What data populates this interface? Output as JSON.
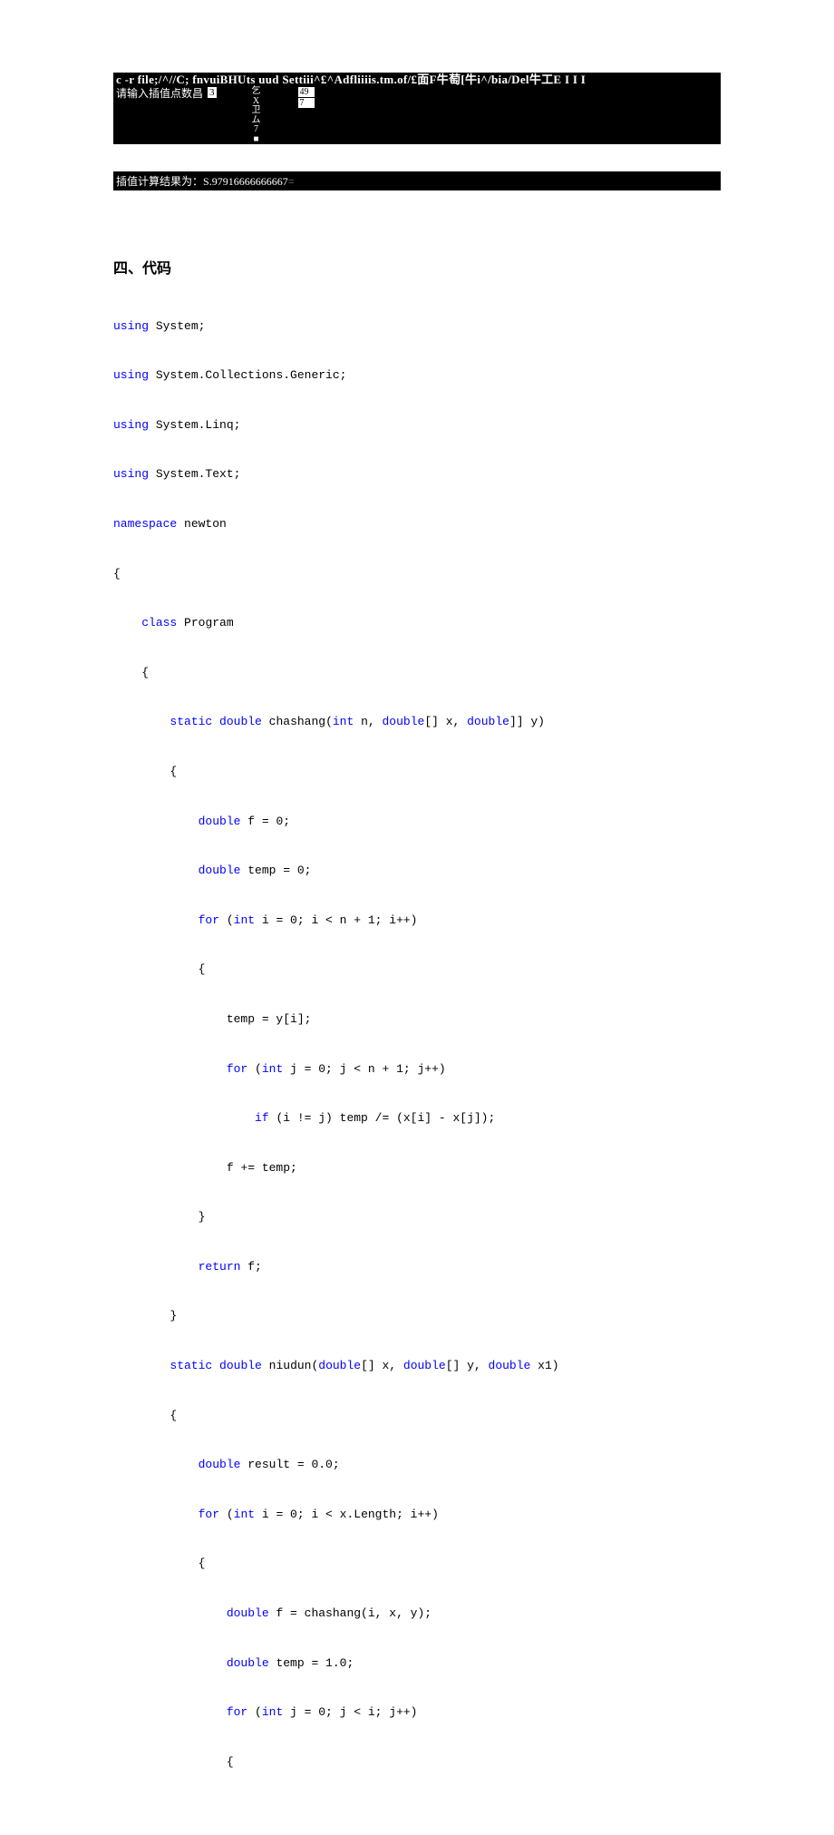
{
  "console": {
    "title": "c -r file;/^//C; fnvuiBHUts uud Settiii^£^Adfliiiis.tm.of/£面F牛萄[牛i^/bia/Del牛工E      I I I",
    "prompt": "请输入插值点数昌",
    "input_count": "3",
    "vertical": [
      "乞",
      "X",
      "卫",
      "ム",
      "7",
      "■"
    ],
    "boxes": [
      "49",
      "7"
    ],
    "result_prefix": "插值计算结果为：",
    "result_value": "S.97916666666667",
    "result_suffix": "="
  },
  "heading": "四、代码",
  "code": {
    "l1a": "using",
    "l1b": " System;",
    "l2a": "using",
    "l2b": " System.Collections.Generic;",
    "l3a": "using",
    "l3b": " System.Linq;",
    "l4a": "using",
    "l4b": " System.Text;",
    "l5a": "namespace",
    "l5b": " newton",
    "l6": "{",
    "l7a": "    ",
    "l7b": "class",
    "l7c": " Program",
    "l8": "    {",
    "l9a": "        ",
    "l9b": "static",
    "l9c": " ",
    "l9d": "double",
    "l9e": " chashang(",
    "l9f": "int",
    "l9g": " n, ",
    "l9h": "double",
    "l9i": "[] x, ",
    "l9j": "double",
    "l9k": "]] y)",
    "l10": "        {",
    "l11a": "            ",
    "l11b": "double",
    "l11c": " f = 0;",
    "l12a": "            ",
    "l12b": "double",
    "l12c": " temp = 0;",
    "l13a": "            ",
    "l13b": "for",
    "l13c": " (",
    "l13d": "int",
    "l13e": " i = 0; i < n + 1; i++)",
    "l14": "            {",
    "l15": "                temp = y[i];",
    "l16a": "                ",
    "l16b": "for",
    "l16c": " (",
    "l16d": "int",
    "l16e": " j = 0; j < n + 1; j++)",
    "l17a": "                    ",
    "l17b": "if",
    "l17c": " (i != j) temp /= (x[i] - x[j]);",
    "l18": "                f += temp;",
    "l19": "            }",
    "l20a": "            ",
    "l20b": "return",
    "l20c": " f;",
    "l21": "        }",
    "l22a": "        ",
    "l22b": "static",
    "l22c": " ",
    "l22d": "double",
    "l22e": " niudun(",
    "l22f": "double",
    "l22g": "[] x, ",
    "l22h": "double",
    "l22i": "[] y, ",
    "l22j": "double",
    "l22k": " x1)",
    "l23": "        {",
    "l24a": "            ",
    "l24b": "double",
    "l24c": " result = 0.0;",
    "l25a": "            ",
    "l25b": "for",
    "l25c": " (",
    "l25d": "int",
    "l25e": " i = 0; i < x.Length; i++)",
    "l26": "            {",
    "l27a": "                ",
    "l27b": "double",
    "l27c": " f = chashang(i, x, y);",
    "l28a": "                ",
    "l28b": "double",
    "l28c": " temp = 1.0;",
    "l29a": "                ",
    "l29b": "for",
    "l29c": " (",
    "l29d": "int",
    "l29e": " j = 0; j < i; j++)",
    "l30": "                {"
  }
}
